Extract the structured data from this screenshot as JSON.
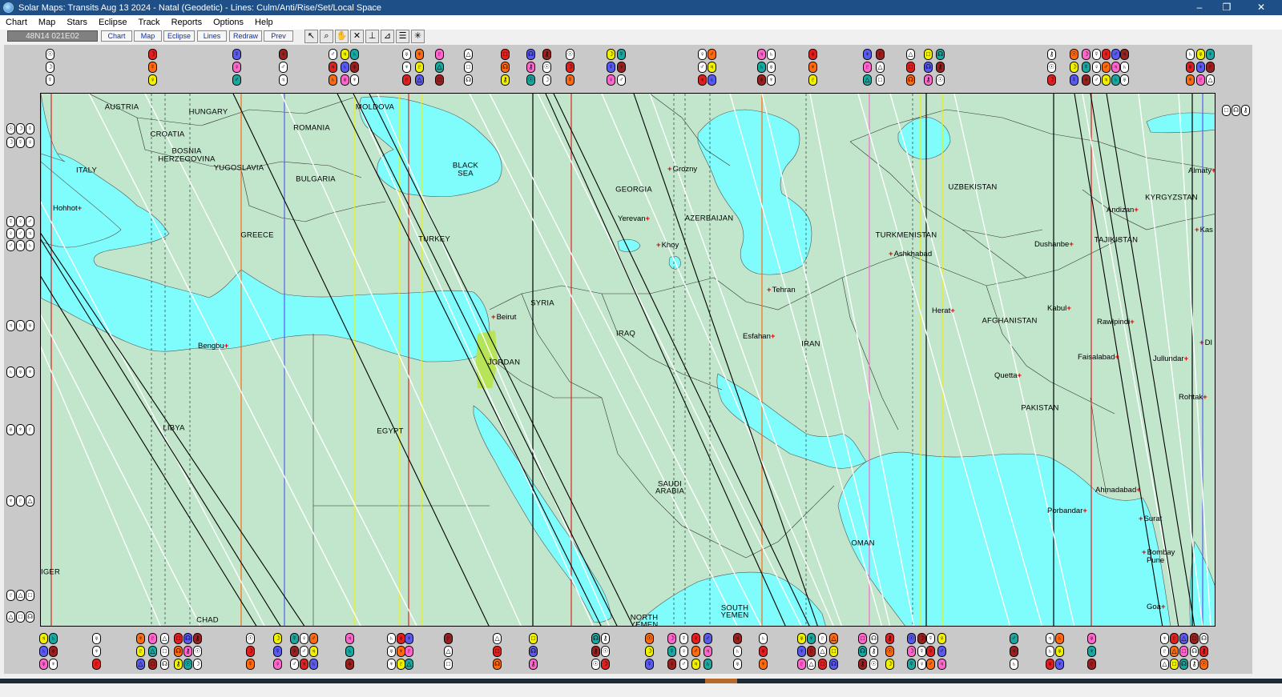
{
  "window": {
    "title": "Solar Maps: Transits Aug 13 2024 - Natal (Geodetic) - Lines: Culm/Anti/Rise/Set/Local Space",
    "minimize": "–",
    "maximize": "❐",
    "close": "✕"
  },
  "menu": [
    "Chart",
    "Map",
    "Stars",
    "Eclipse",
    "Track",
    "Reports",
    "Options",
    "Help"
  ],
  "toolbar": {
    "coordinates": "48N14 021E02",
    "buttons": [
      "Chart",
      "Map",
      "Eclipse",
      "Lines",
      "Redraw",
      "Prev"
    ],
    "tool_icons": [
      "pointer-icon",
      "zoom-icon",
      "hand-icon",
      "cross-lines-icon",
      "measure-icon",
      "plot-icon",
      "list-icon",
      "star-icon"
    ]
  },
  "colors": {
    "water": "#7ffcfc",
    "land": "#c1e6cc",
    "highlight": "#b7e34a",
    "red_line": "#e02020",
    "yellow_line": "#f0f000",
    "blue_line": "#5a5af0",
    "orange_line": "#ff6a10",
    "pink_line": "#ff66cc",
    "black_line": "#000000",
    "white_line": "#ffffff"
  },
  "countries": [
    {
      "name": "AUSTRIA"
    },
    {
      "name": "HUNGARY"
    },
    {
      "name": "MOLDOVA"
    },
    {
      "name": "CROATIA"
    },
    {
      "name": "ROMANIA"
    },
    {
      "name": "BOSNIA"
    },
    {
      "name": "HERZEGOVINA"
    },
    {
      "name": "YUGOSLAVIA"
    },
    {
      "name": "ITALY"
    },
    {
      "name": "BULGARIA"
    },
    {
      "name": "BLACK"
    },
    {
      "name": "SEA"
    },
    {
      "name": "GEORGIA"
    },
    {
      "name": "AZERBAIJAN"
    },
    {
      "name": "UZBEKISTAN"
    },
    {
      "name": "KYRGYZSTAN"
    },
    {
      "name": "TURKMENISTAN"
    },
    {
      "name": "TAJIKISTAN"
    },
    {
      "name": "GREECE"
    },
    {
      "name": "TURKEY"
    },
    {
      "name": "SYRIA"
    },
    {
      "name": "IRAQ"
    },
    {
      "name": "IRAN"
    },
    {
      "name": "AFGHANISTAN"
    },
    {
      "name": "JORDAN"
    },
    {
      "name": "LIBYA"
    },
    {
      "name": "EGYPT"
    },
    {
      "name": "PAKISTAN"
    },
    {
      "name": "SAUDI"
    },
    {
      "name": "ARABIA"
    },
    {
      "name": "OMAN"
    },
    {
      "name": "NORTH"
    },
    {
      "name": "YEMEN"
    },
    {
      "name": "SOUTH"
    },
    {
      "name": "CHAD"
    },
    {
      "name": "IGER"
    }
  ],
  "cities": [
    {
      "name": "Hohhot"
    },
    {
      "name": "Grozny"
    },
    {
      "name": "Almaty"
    },
    {
      "name": "Yerevan"
    },
    {
      "name": "Andizan"
    },
    {
      "name": "Khoy"
    },
    {
      "name": "Dushanbe"
    },
    {
      "name": "Ashkhabad"
    },
    {
      "name": "Kas"
    },
    {
      "name": "Beirut"
    },
    {
      "name": "Tehran"
    },
    {
      "name": "Herat"
    },
    {
      "name": "Kabul"
    },
    {
      "name": "Rawlpindi"
    },
    {
      "name": "Bengbu"
    },
    {
      "name": "Esfahan"
    },
    {
      "name": "Faisalabad"
    },
    {
      "name": "Jullundar"
    },
    {
      "name": "DI"
    },
    {
      "name": "Quetta"
    },
    {
      "name": "Rohtak"
    },
    {
      "name": "Ahmadabad"
    },
    {
      "name": "Porbandar"
    },
    {
      "name": "Surat"
    },
    {
      "name": "Bombay"
    },
    {
      "name": "Pune"
    },
    {
      "name": "Goa"
    }
  ]
}
